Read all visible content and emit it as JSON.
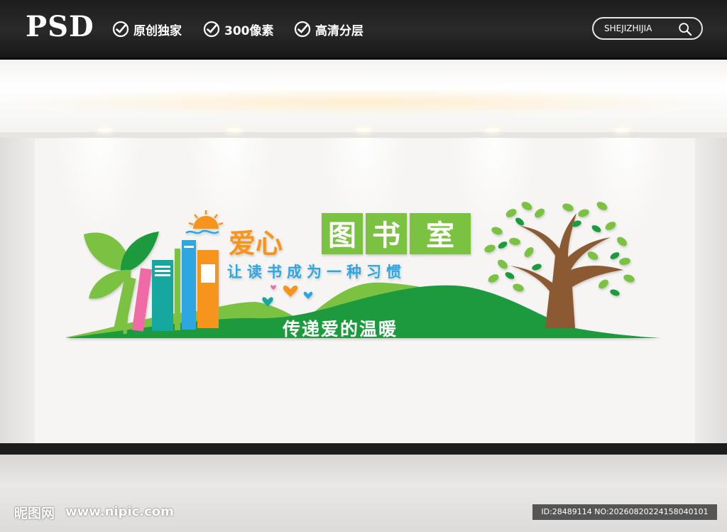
{
  "header": {
    "logo": "PSD",
    "features": [
      "原创独家",
      "300像素",
      "高清分层"
    ],
    "search_label": "SHEJIZHIJIA"
  },
  "sign": {
    "title_part1": "爱心",
    "title_chars": [
      "图",
      "书",
      "室"
    ],
    "subtitle": "让读书成为一种习惯",
    "slogan": "传递爱的温暖"
  },
  "watermark": {
    "logo": "昵图网",
    "url": "www.nipic.com",
    "id": "ID:28489114 NO:20260820224158040101"
  },
  "colors": {
    "green": "#7cc242",
    "dark_green": "#1e9a3e",
    "orange": "#f7941d",
    "blue": "#2ea6e0",
    "pink": "#f06aa5",
    "teal": "#14a7a0",
    "brown": "#8c5a32"
  }
}
